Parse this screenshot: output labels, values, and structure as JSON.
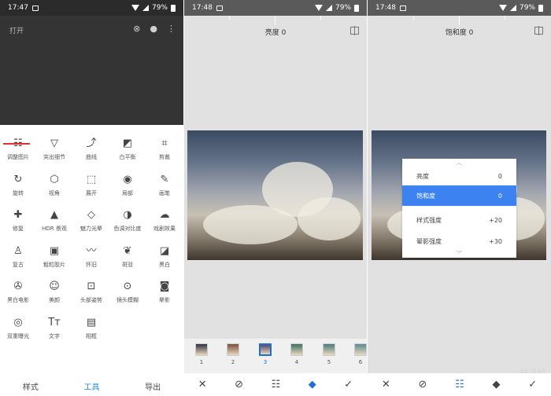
{
  "panel1": {
    "status": {
      "time": "17:47",
      "battery": "79%"
    },
    "open_label": "打开",
    "tools": [
      {
        "icon": "☷",
        "icon_name": "tune-image-icon",
        "label": "调整图片"
      },
      {
        "icon": "▽",
        "icon_name": "details-icon",
        "label": "突出细节"
      },
      {
        "icon": "⤴",
        "icon_name": "curves-icon",
        "label": "曲线"
      },
      {
        "icon": "◩",
        "icon_name": "white-balance-icon",
        "label": "白平衡"
      },
      {
        "icon": "⌗",
        "icon_name": "crop-icon",
        "label": "剪裁"
      },
      {
        "icon": "↻",
        "icon_name": "rotate-icon",
        "label": "旋转"
      },
      {
        "icon": "⬡",
        "icon_name": "perspective-icon",
        "label": "视角"
      },
      {
        "icon": "⬚",
        "icon_name": "expand-icon",
        "label": "展开"
      },
      {
        "icon": "◉",
        "icon_name": "selective-icon",
        "label": "局部"
      },
      {
        "icon": "✎",
        "icon_name": "brush-icon",
        "label": "画笔"
      },
      {
        "icon": "✚",
        "icon_name": "healing-icon",
        "label": "修复"
      },
      {
        "icon": "▲",
        "icon_name": "hdr-icon",
        "label": "HDR 景观"
      },
      {
        "icon": "◇",
        "icon_name": "glamour-glow-icon",
        "label": "魅力光晕"
      },
      {
        "icon": "◑",
        "icon_name": "tonal-contrast-icon",
        "label": "色调对比度"
      },
      {
        "icon": "☁",
        "icon_name": "drama-icon",
        "label": "戏剧效果"
      },
      {
        "icon": "♙",
        "icon_name": "vintage-icon",
        "label": "复古"
      },
      {
        "icon": "▣",
        "icon_name": "grainy-film-icon",
        "label": "粗粒胶片"
      },
      {
        "icon": "〰",
        "icon_name": "retrolux-icon",
        "label": "怀旧"
      },
      {
        "icon": "❦",
        "icon_name": "grunge-icon",
        "label": "斑驳"
      },
      {
        "icon": "◪",
        "icon_name": "black-white-icon",
        "label": "黑白"
      },
      {
        "icon": "✇",
        "icon_name": "noir-icon",
        "label": "黑白电影"
      },
      {
        "icon": "☺",
        "icon_name": "portrait-icon",
        "label": "美颜"
      },
      {
        "icon": "⊡",
        "icon_name": "head-pose-icon",
        "label": "头部姿势"
      },
      {
        "icon": "⊙",
        "icon_name": "lens-blur-icon",
        "label": "镜头模糊"
      },
      {
        "icon": "◙",
        "icon_name": "vignette-icon",
        "label": "晕影"
      },
      {
        "icon": "◎",
        "icon_name": "double-exposure-icon",
        "label": "双重曝光"
      },
      {
        "icon": "Tт",
        "icon_name": "text-icon",
        "label": "文字"
      },
      {
        "icon": "▤",
        "icon_name": "frames-icon",
        "label": "相框"
      }
    ],
    "nav": {
      "styles": "样式",
      "tools": "工具",
      "export": "导出"
    }
  },
  "panel2": {
    "status": {
      "time": "17:48",
      "battery": "79%"
    },
    "title": "亮度 0",
    "filters": [
      {
        "num": "1",
        "color": "#2f3340"
      },
      {
        "num": "2",
        "color": "#7a4e3d"
      },
      {
        "num": "3",
        "color": "#5b4a66"
      },
      {
        "num": "4",
        "color": "#3f6f5e"
      },
      {
        "num": "5",
        "color": "#4a7b78"
      },
      {
        "num": "6",
        "color": "#5a8a92"
      }
    ],
    "selected_filter": "3"
  },
  "panel3": {
    "status": {
      "time": "17:48",
      "battery": "79%"
    },
    "title": "饱和度 0",
    "menu": [
      {
        "label": "亮度",
        "value": "0"
      },
      {
        "label": "饱和度",
        "value": "0"
      },
      {
        "label": "样式强度",
        "value": "+20"
      },
      {
        "label": "晕影强度",
        "value": "+30"
      }
    ],
    "watermark": "蜂鸟网"
  },
  "icons": {
    "close": "✕",
    "check": "✓",
    "tune": "☷",
    "style": "◆",
    "compare": "compare-icon"
  }
}
